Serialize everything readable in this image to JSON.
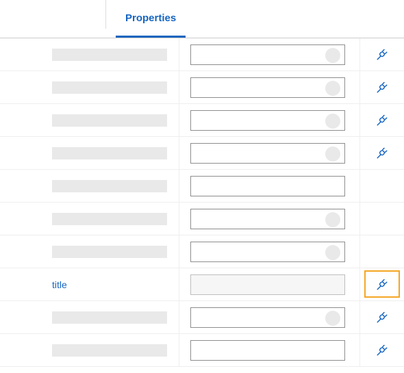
{
  "tabs": {
    "active": "Properties"
  },
  "colors": {
    "accent": "#1565c0",
    "highlight": "#f5a623",
    "skeleton": "#e9e9e9"
  },
  "rows": [
    {
      "label": null,
      "label_w": 168,
      "select": true,
      "bind": true,
      "highlight": false,
      "disabled": false
    },
    {
      "label": null,
      "label_w": 168,
      "select": true,
      "bind": true,
      "highlight": false,
      "disabled": false
    },
    {
      "label": null,
      "label_w": 168,
      "select": true,
      "bind": true,
      "highlight": false,
      "disabled": false
    },
    {
      "label": null,
      "label_w": 168,
      "select": true,
      "bind": true,
      "highlight": false,
      "disabled": false
    },
    {
      "label": null,
      "label_w": 168,
      "select": false,
      "bind": false,
      "highlight": false,
      "disabled": false
    },
    {
      "label": null,
      "label_w": 168,
      "select": true,
      "bind": false,
      "highlight": false,
      "disabled": false
    },
    {
      "label": null,
      "label_w": 168,
      "select": true,
      "bind": false,
      "highlight": false,
      "disabled": false
    },
    {
      "label": "title",
      "label_w": null,
      "select": false,
      "bind": true,
      "highlight": true,
      "disabled": true
    },
    {
      "label": null,
      "label_w": 168,
      "select": true,
      "bind": true,
      "highlight": false,
      "disabled": false
    },
    {
      "label": null,
      "label_w": 168,
      "select": false,
      "bind": true,
      "highlight": false,
      "disabled": false
    }
  ]
}
